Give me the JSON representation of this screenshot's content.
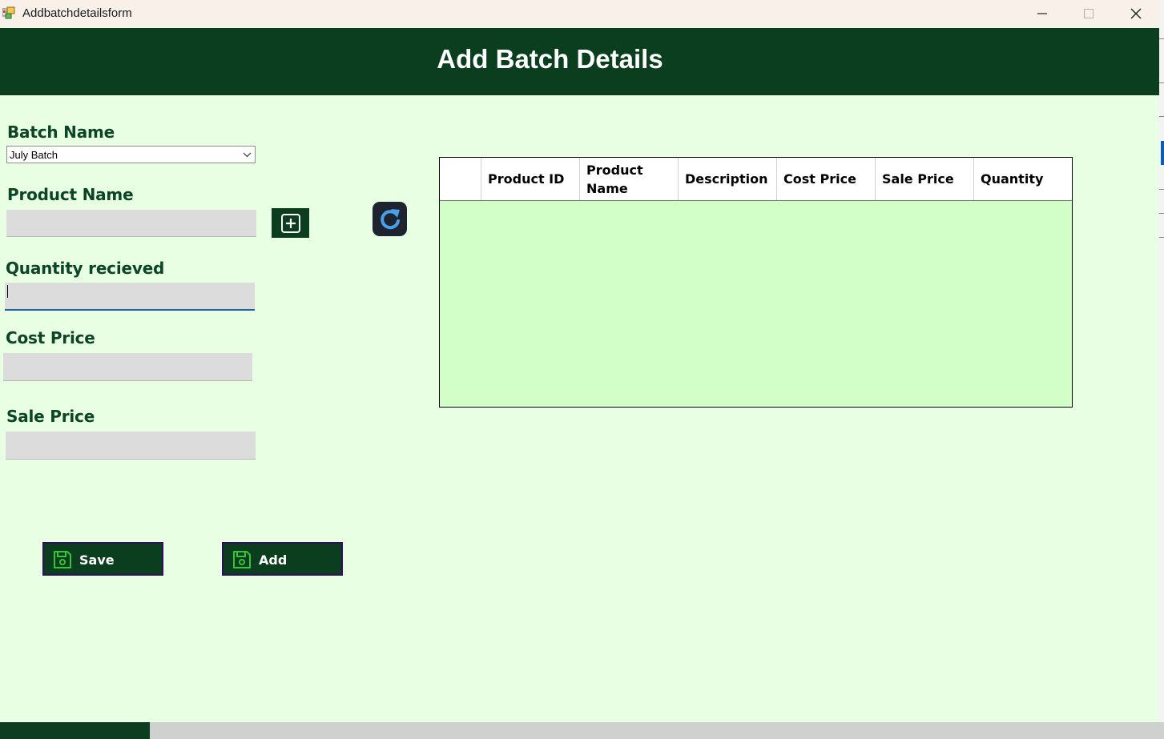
{
  "window": {
    "title": "Addbatchdetailsform",
    "minimize_icon": "minimize-icon",
    "maximize_icon": "maximize-icon",
    "close_icon": "close-icon"
  },
  "header": {
    "title": "Add Batch Details"
  },
  "form": {
    "batch_name": {
      "label": "Batch Name",
      "value": "July Batch"
    },
    "product_name": {
      "label": "Product Name",
      "value": ""
    },
    "quantity_received": {
      "label": "Quantity recieved",
      "value": ""
    },
    "cost_price": {
      "label": "Cost Price",
      "value": ""
    },
    "sale_price": {
      "label": "Sale Price",
      "value": ""
    }
  },
  "icons": {
    "add_product": "plus-square-icon",
    "refresh": "refresh-icon",
    "save": "floppy-disk-icon"
  },
  "table": {
    "columns": [
      "",
      "Product ID",
      "Product Name",
      "Description",
      "Cost Price",
      "Sale Price",
      "Quantity"
    ],
    "rows": []
  },
  "buttons": {
    "save": "Save",
    "add": "Add"
  },
  "colors": {
    "header_bg": "#0b3e1f",
    "form_bg": "#e8ffe3",
    "grid_bg": "#d2ffc8",
    "label_text": "#0c4426",
    "input_bg": "#dcdcdc"
  }
}
